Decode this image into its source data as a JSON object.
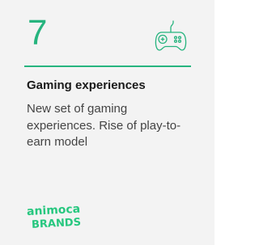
{
  "card": {
    "number": "7",
    "title": "Gaming experiences",
    "description": "New set of gaming experiences. Rise of play-to-earn model",
    "icon": "gamepad-icon"
  },
  "logo": {
    "line1": "animoca",
    "line2": "BRANDS"
  },
  "colors": {
    "accent": "#26b47e",
    "logo_green": "#27c77f",
    "card_bg": "#f3f3f3",
    "title": "#1a1a1a",
    "text": "#444444"
  }
}
